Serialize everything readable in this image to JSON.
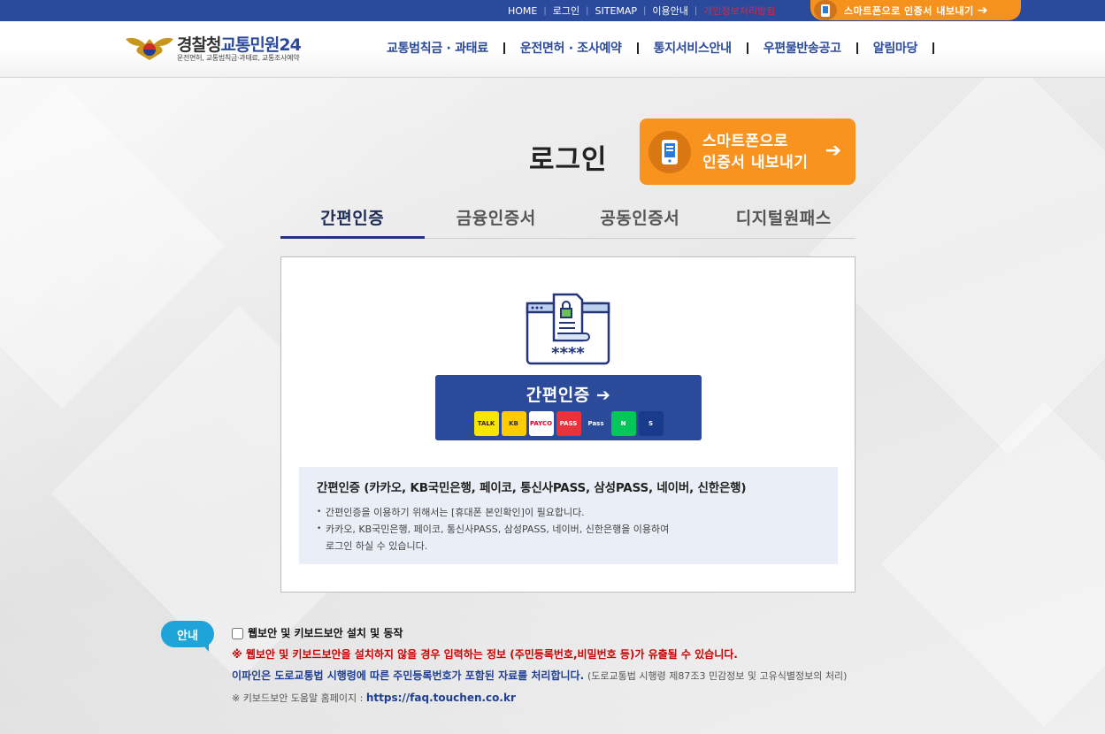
{
  "topbar": {
    "links": [
      "HOME",
      "로그인",
      "SITEMAP",
      "이용안내",
      "개인정보처리방침"
    ],
    "smart_label": "스마트폰으로 인증서 내보내기"
  },
  "header": {
    "logo_main": "경찰청",
    "logo_accent": "교통민원24",
    "logo_sub": "운전면허, 교통범칙금·과태료, 교통조사예약",
    "nav": [
      "교통범칙금 · 과태료",
      "운전면허 · 조사예약",
      "통지서비스안내",
      "우편물반송공고",
      "알림마당"
    ]
  },
  "login": {
    "title": "로그인",
    "export_line1": "스마트폰으로",
    "export_line2": "인증서 내보내기",
    "tabs": [
      "간편인증",
      "금융인증서",
      "공동인증서",
      "디지털원패스"
    ],
    "simple_button": "간편인증",
    "providers": [
      {
        "name": "TALK",
        "bg": "#f7e600",
        "fg": "#3c1e1e"
      },
      {
        "name": "KB",
        "bg": "#ffcc00",
        "fg": "#333333"
      },
      {
        "name": "PAYCO",
        "bg": "#ffffff",
        "fg": "#e4002b"
      },
      {
        "name": "PASS",
        "bg": "#e8323c",
        "fg": "#ffffff"
      },
      {
        "name": "Pass",
        "bg": "#2c4a9a",
        "fg": "#ffffff"
      },
      {
        "name": "N",
        "bg": "#03c75a",
        "fg": "#ffffff"
      },
      {
        "name": "S",
        "bg": "#1a3b8c",
        "fg": "#ffffff"
      }
    ],
    "info_title": "간편인증 (카카오, KB국민은행, 페이코, 통신사PASS, 삼성PASS, 네이버, 신한은행)",
    "info_item1": "간편인증을 이용하기 위해서는 [휴대폰 본인확인]이 필요합니다.",
    "info_item2a": "카카오, KB국민은행, 페이코, 통신사PASS, 삼성PASS, 네이버, 신한은행을 이용하여",
    "info_item2b": "로그인 하실 수 있습니다."
  },
  "notice": {
    "badge": "안내",
    "checkbox_label": "웹보안 및 키보드보안 설치 및 동작",
    "warning": "※ 웹보안 및 키보드보안을 설치하지 않을 경우 입력하는 정보 (주민등록번호,비밀번호 등)가 유출될 수 있습니다.",
    "law_bold": "이파인은 도로교통법 시행령에 따른 주민등록번호가 포함된 자료를 처리합니다.",
    "law_note": "(도로교통법 시행령 제87조3 민감정보 및 고유식별정보의 처리)",
    "help_prefix": "※ 키보드보안 도움말 홈페이지 : ",
    "help_url": "https://faq.touchen.co.kr"
  },
  "colors": {
    "primary": "#2b4a9b",
    "accent": "#f7931e",
    "warning": "#cc0000",
    "badge": "#1ea4d8"
  }
}
